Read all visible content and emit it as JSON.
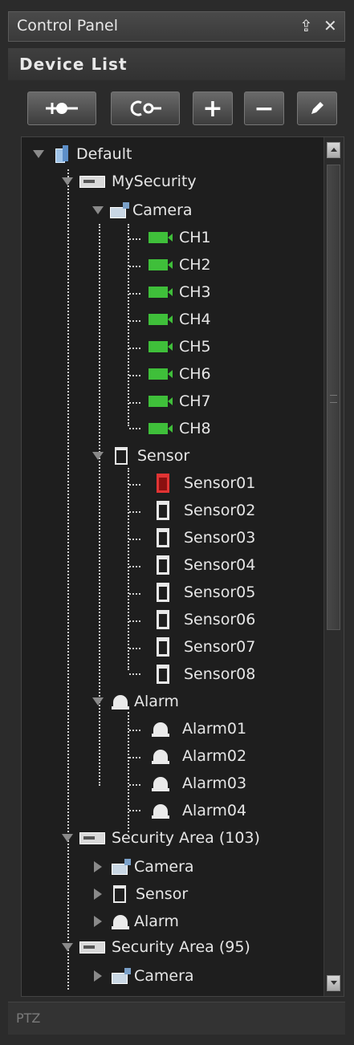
{
  "window": {
    "title": "Control Panel"
  },
  "device_list": {
    "header": "Device List"
  },
  "toolbar": {
    "buttons": [
      {
        "name": "connect",
        "icon": "connect-icon"
      },
      {
        "name": "disconnect",
        "icon": "disconnect-icon"
      },
      {
        "name": "add",
        "icon": "plus-icon",
        "label": "+"
      },
      {
        "name": "remove",
        "icon": "minus-icon",
        "label": "−"
      },
      {
        "name": "edit",
        "icon": "pencil-icon"
      }
    ]
  },
  "tree": {
    "root": "Default",
    "mysecurity": "MySecurity",
    "camera": "Camera",
    "channels": [
      "CH1",
      "CH2",
      "CH3",
      "CH4",
      "CH5",
      "CH6",
      "CH7",
      "CH8"
    ],
    "sensor": "Sensor",
    "sensors": [
      "Sensor01",
      "Sensor02",
      "Sensor03",
      "Sensor04",
      "Sensor05",
      "Sensor06",
      "Sensor07",
      "Sensor08"
    ],
    "alarm": "Alarm",
    "alarms": [
      "Alarm01",
      "Alarm02",
      "Alarm03",
      "Alarm04"
    ],
    "area1": "Security Area (103)",
    "area1_camera": "Camera",
    "area1_sensor": "Sensor",
    "area1_alarm": "Alarm",
    "area2": "Security Area (95)",
    "area2_camera": "Camera"
  },
  "footer": {
    "ptz_label": "PTZ"
  },
  "colors": {
    "camera_green": "#3fbf3a",
    "sensor_alert_red": "#e23434",
    "background": "#2b2b2b"
  }
}
